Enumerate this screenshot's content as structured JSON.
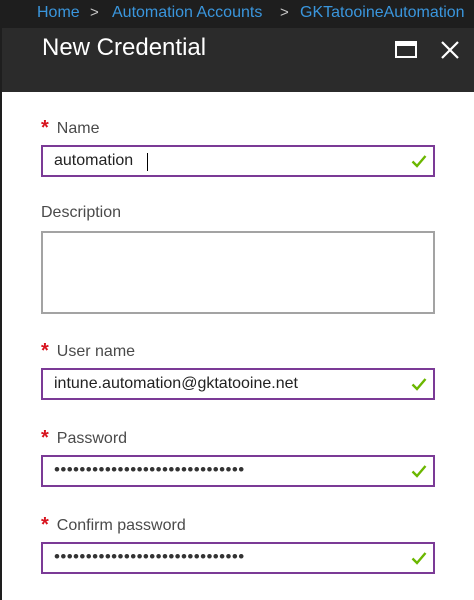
{
  "breadcrumb": {
    "items": [
      "Home",
      "Automation Accounts",
      "GKTatooineAutomation"
    ],
    "separator": ">"
  },
  "blade": {
    "title": "New Credential",
    "maximize_icon": "maximize-icon",
    "close_icon": "close-icon"
  },
  "form": {
    "required_marker": "*",
    "name": {
      "label": "Name",
      "value": "automation",
      "required": true,
      "valid": true
    },
    "description": {
      "label": "Description",
      "value": "",
      "required": false
    },
    "username": {
      "label": "User name",
      "value": "intune.automation@gktatooine.net",
      "required": true,
      "valid": true
    },
    "password": {
      "label": "Password",
      "masked_value": "••••••••••••••••••••••••••••••",
      "required": true,
      "valid": true
    },
    "confirm_password": {
      "label": "Confirm password",
      "masked_value": "••••••••••••••••••••••••••••••",
      "required": true,
      "valid": true
    }
  },
  "colors": {
    "accent_link": "#3a96dd",
    "header_bg": "#2b2b2b",
    "focus_border": "#7b3a96",
    "required_star": "#d8131e",
    "valid_check": "#6bb700"
  }
}
